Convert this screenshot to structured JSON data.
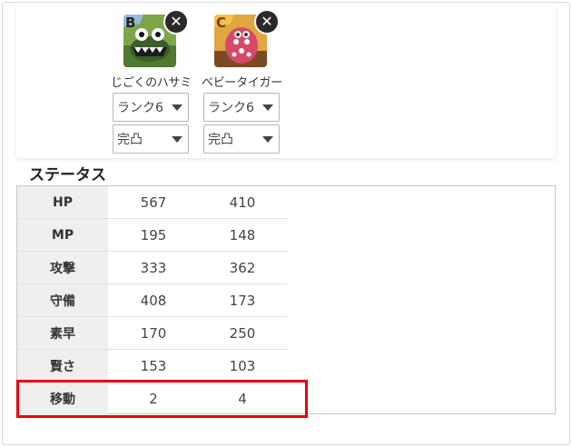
{
  "monsters": [
    {
      "name": "じごくのハサミ",
      "rank": "ランク6",
      "kantotsu": "完凸",
      "portrait_letter": "B",
      "portrait_colors": {
        "bg": "#6b8f3a",
        "accent": "#3b5d2a",
        "letter": "#222222"
      }
    },
    {
      "name": "ベビータイガー",
      "rank": "ランク6",
      "kantotsu": "完凸",
      "portrait_letter": "C",
      "portrait_colors": {
        "bg": "#d9902f",
        "accent": "#c2405a",
        "letter": "#7a3b12"
      }
    }
  ],
  "remove_icon": "close-icon",
  "section_title": "ステータス",
  "stats": [
    {
      "label": "HP",
      "values": [
        "567",
        "410"
      ]
    },
    {
      "label": "MP",
      "values": [
        "195",
        "148"
      ]
    },
    {
      "label": "攻撃",
      "values": [
        "333",
        "362"
      ]
    },
    {
      "label": "守備",
      "values": [
        "408",
        "173"
      ]
    },
    {
      "label": "素早",
      "values": [
        "170",
        "250"
      ]
    },
    {
      "label": "賢さ",
      "values": [
        "153",
        "103"
      ]
    },
    {
      "label": "移動",
      "values": [
        "2",
        "4"
      ]
    }
  ],
  "highlight_color": "#e60012"
}
